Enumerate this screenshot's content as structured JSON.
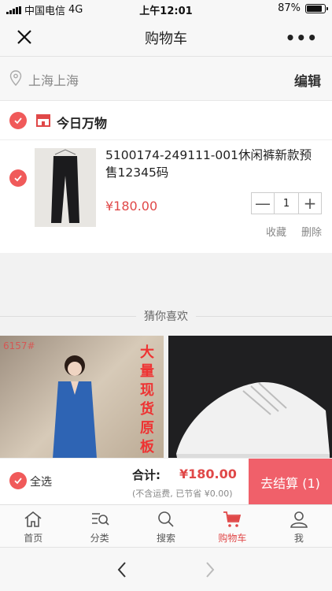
{
  "status": {
    "carrier": "中国电信",
    "network": "4G",
    "time": "上午12:01",
    "battery": "87%",
    "battery_level": 0.87
  },
  "nav": {
    "title": "购物车",
    "more": "•••"
  },
  "location": {
    "address": "上海上海",
    "edit": "编辑"
  },
  "store": {
    "name": "今日万物",
    "item": {
      "name": "5100174-249111-001休闲裤新款预售12345码",
      "price": "¥180.00",
      "quantity": "1",
      "minus": "—",
      "plus": "+",
      "favorite": "收藏",
      "delete": "删除"
    }
  },
  "guess": {
    "title": "猜你喜欢",
    "rec1_tag": "6157#",
    "rec1_text": "大量现货原板"
  },
  "checkout": {
    "select_all": "全选",
    "total_label": "合计:",
    "total": "¥180.00",
    "note": "(不含运费, 已节省 ¥0.00)",
    "pay": "去结算 (1)"
  },
  "tabs": [
    {
      "label": "首页",
      "icon": "home-icon"
    },
    {
      "label": "分类",
      "icon": "category-icon"
    },
    {
      "label": "搜索",
      "icon": "search-icon"
    },
    {
      "label": "购物车",
      "icon": "cart-icon"
    },
    {
      "label": "我",
      "icon": "user-icon"
    }
  ],
  "colors": {
    "accent": "#e04848",
    "pay_button": "#f0606a",
    "check": "#f05a5a"
  }
}
